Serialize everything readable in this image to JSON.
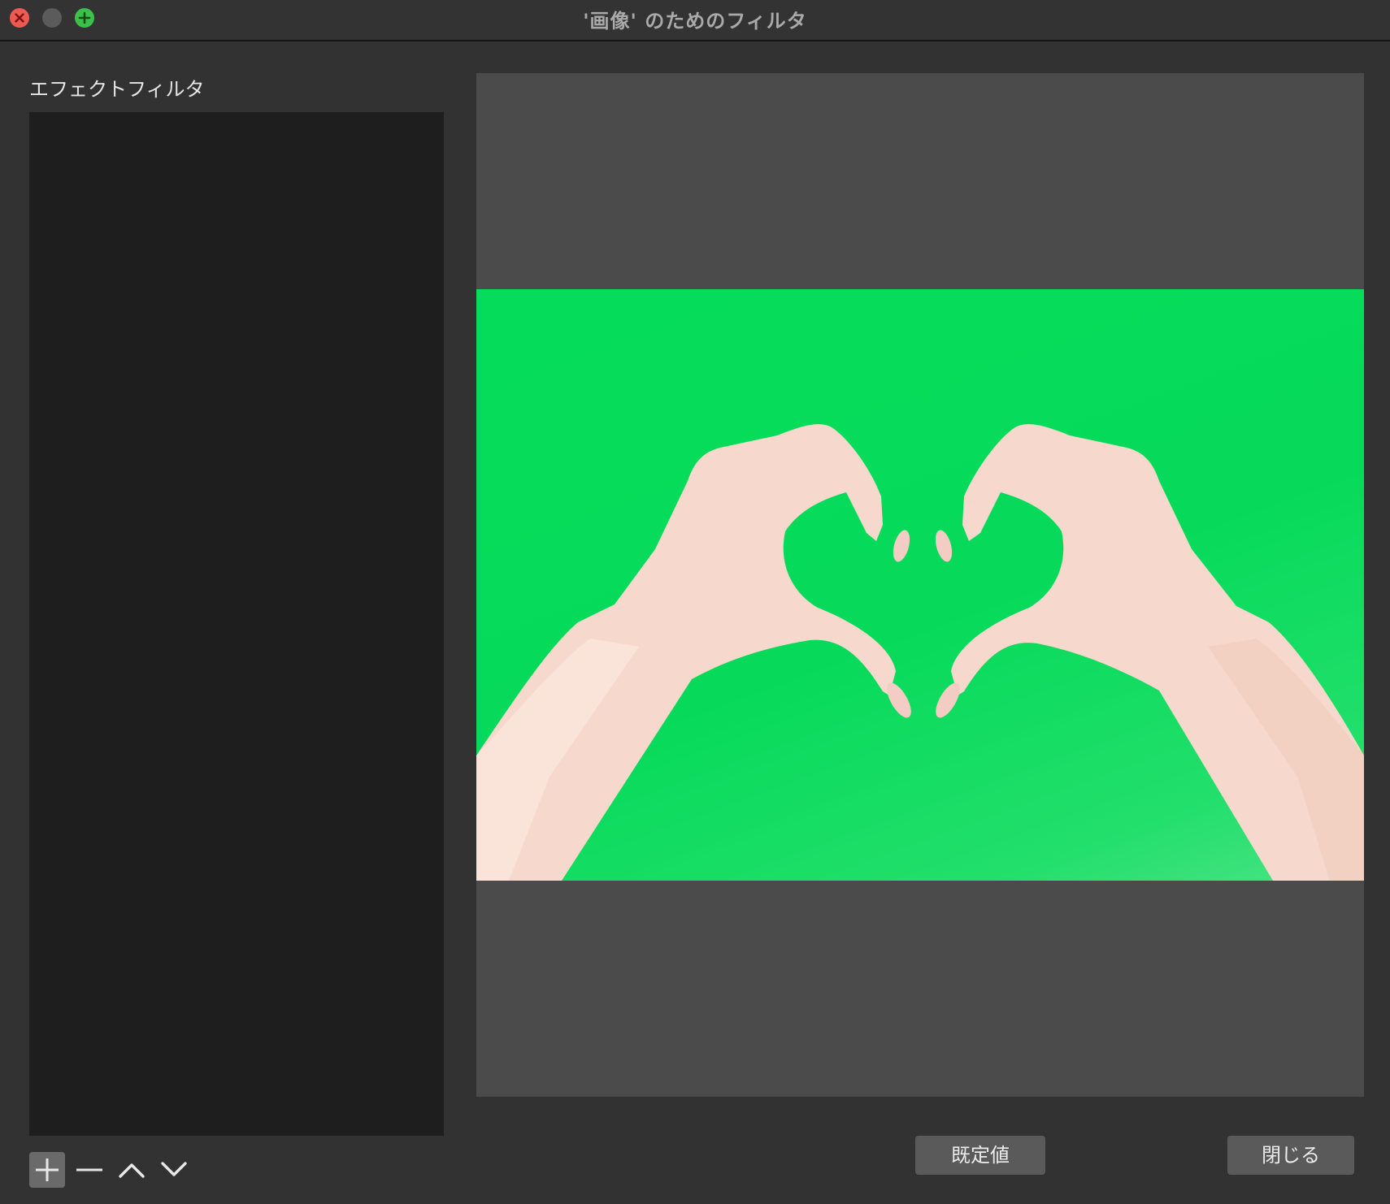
{
  "window": {
    "title": "'画像' のためのフィルタ",
    "controls": [
      "close-icon",
      "minimize-icon",
      "zoom-icon"
    ]
  },
  "sidebar": {
    "heading": "エフェクトフィルタ",
    "filters": [],
    "tools": [
      "plus-icon",
      "minus-icon",
      "chevron-up-icon",
      "chevron-down-icon"
    ]
  },
  "preview": {
    "image_subject": "hands forming a heart on green background",
    "background_color": "#07da5b"
  },
  "buttons": {
    "default_label": "既定値",
    "close_label": "閉じる"
  },
  "colors": {
    "window_bg": "#323232",
    "list_bg": "#1e1e1e",
    "preview_bg": "#4b4b4b",
    "close_red": "#ee5a52",
    "zoom_green": "#3cc04a"
  }
}
